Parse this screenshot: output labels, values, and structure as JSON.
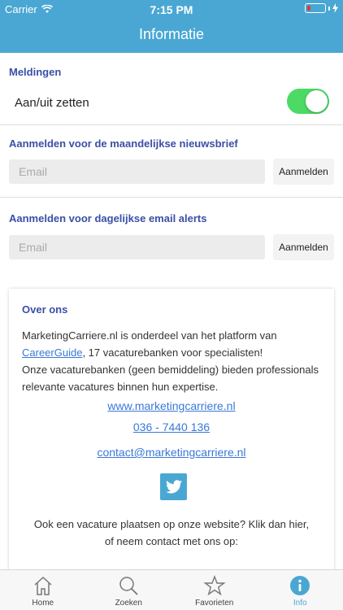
{
  "status_bar": {
    "carrier": "Carrier",
    "time": "7:15 PM"
  },
  "header": {
    "title": "Informatie"
  },
  "notifications": {
    "section_title": "Meldingen",
    "toggle_label": "Aan/uit zetten",
    "toggle_on": true
  },
  "newsletter": {
    "section_title": "Aanmelden voor de maandelijkse nieuwsbrief",
    "placeholder": "Email",
    "button_label": "Aanmelden"
  },
  "alerts": {
    "section_title": "Aanmelden voor dagelijkse email alerts",
    "placeholder": "Email",
    "button_label": "Aanmelden"
  },
  "about": {
    "title": "Over ons",
    "intro_before_link": "MarketingCarriere.nl is onderdeel van het platform van ",
    "career_guide_link": "CareerGuide",
    "intro_after_link": ", 17 vacaturebanken voor specialisten!",
    "description": "Onze vacaturebanken (geen bemiddeling) bieden professionals relevante vacatures binnen hun expertise.",
    "website": "www.marketingcarriere.nl",
    "phone": "036 - 7440 136",
    "email": "contact@marketingcarriere.nl",
    "footer_before_link": "Ook een vacature plaatsen op onze website? Klik dan ",
    "footer_link": "hier",
    "footer_after_link": ",",
    "footer_line2": "of neem contact met ons op:"
  },
  "tabs": [
    {
      "label": "Home",
      "icon": "home-icon"
    },
    {
      "label": "Zoeken",
      "icon": "search-icon"
    },
    {
      "label": "Favorieten",
      "icon": "star-icon"
    },
    {
      "label": "Info",
      "icon": "info-icon"
    }
  ],
  "colors": {
    "primary": "#4aa7d3",
    "section_title": "#3a4fa6",
    "toggle_on": "#4cd964",
    "link": "#3a78d8",
    "battery_low": "#e23b3b"
  }
}
